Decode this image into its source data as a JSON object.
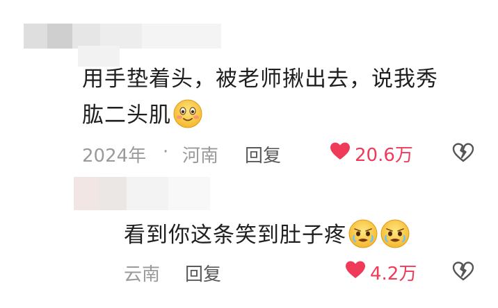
{
  "comments": [
    {
      "text_line1": "用手垫着头，被老师揪出去，说我秀",
      "text_line2": "肱二头肌",
      "emoji": "smiling-blush-icon",
      "year": "2024年",
      "separator": "·",
      "location": "河南",
      "reply_label": "回复",
      "likes": "20.6万"
    },
    {
      "text": "看到你这条笑到肚子疼",
      "emoji": "crying-laugh-icon",
      "location": "云南",
      "reply_label": "回复",
      "likes": "4.2万"
    }
  ],
  "colors": {
    "like": "#f03a5a",
    "meta": "#9a9a9a",
    "text": "#1f1f1f"
  }
}
